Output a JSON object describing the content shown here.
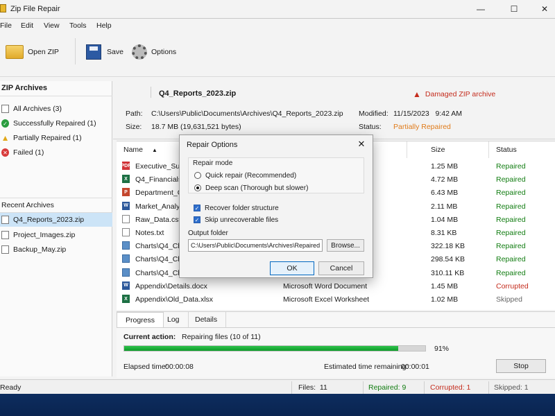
{
  "window": {
    "title": "Zip File Repair",
    "controls": {
      "minimize": "—",
      "maximize": "☐",
      "close": "✕"
    }
  },
  "menu": [
    "File",
    "Edit",
    "View",
    "Tools",
    "Help"
  ],
  "toolbar": {
    "open_label": "Open ZIP",
    "save_label": "Save",
    "options_label": "Options"
  },
  "sidebar": {
    "archives_title": "ZIP Archives",
    "filters": [
      {
        "label": "All Archives (3)",
        "icon": "files-icon"
      },
      {
        "label": "Successfully Repaired (1)",
        "icon": "check-circle-icon"
      },
      {
        "label": "Partially Repaired (1)",
        "icon": "warning-icon"
      },
      {
        "label": "Failed (1)",
        "icon": "error-icon"
      }
    ],
    "recent_title": "Recent Archives",
    "recent": [
      "Q4_Reports_2023.zip",
      "Project_Images.zip",
      "Backup_May.zip"
    ],
    "selected_recent": 0
  },
  "archive": {
    "name": "Q4_Reports_2023.zip",
    "warning": "Damaged ZIP archive",
    "path_label": "Path:",
    "path": "C:\\Users\\Public\\Documents\\Archives\\Q4_Reports_2023.zip",
    "size_label": "Size:",
    "size": "18.7 MB (19,631,521 bytes)",
    "modified_label": "Modified:",
    "modified": "11/15/2023   9:42 AM",
    "status_label": "Status:",
    "status": "Partially Repaired",
    "status_color": "#e07b1a"
  },
  "file_list": {
    "columns": {
      "name": "Name",
      "size": "Size",
      "status": "Status"
    },
    "sort_arrow": "▲",
    "rows": [
      {
        "icon": "pdf",
        "name": "Executive_Sum",
        "type": "",
        "size": "1.25 MB",
        "status": "Repaired"
      },
      {
        "icon": "xls",
        "name": "Q4_Financials.x",
        "type": "",
        "size": "4.72 MB",
        "status": "Repaired"
      },
      {
        "icon": "ppt",
        "name": "Department_O",
        "type": "",
        "size": "6.43 MB",
        "status": "Repaired"
      },
      {
        "icon": "doc",
        "name": "Market_Analys",
        "type": "",
        "size": "2.11 MB",
        "status": "Repaired"
      },
      {
        "icon": "csv",
        "name": "Raw_Data.csv",
        "type": "",
        "size": "1.04 MB",
        "status": "Repaired"
      },
      {
        "icon": "txt",
        "name": "Notes.txt",
        "type": "",
        "size": "8.31 KB",
        "status": "Repaired"
      },
      {
        "icon": "img",
        "name": "Charts\\Q4_Cha",
        "type": "",
        "size": "322.18 KB",
        "status": "Repaired"
      },
      {
        "icon": "img",
        "name": "Charts\\Q4_Cha",
        "type": "",
        "size": "298.54 KB",
        "status": "Repaired"
      },
      {
        "icon": "img",
        "name": "Charts\\Q4_Cha",
        "type": "",
        "size": "310.11 KB",
        "status": "Repaired"
      },
      {
        "icon": "doc",
        "name": "Appendix\\Details.docx",
        "type": "Microsoft Word Document",
        "size": "1.45 MB",
        "status": "Corrupted"
      },
      {
        "icon": "xls",
        "name": "Appendix\\Old_Data.xlsx",
        "type": "Microsoft Excel Worksheet",
        "size": "1.02 MB",
        "status": "Skipped"
      }
    ]
  },
  "progress": {
    "tabs": [
      "Progress",
      "Log",
      "Details"
    ],
    "current_action_label": "Current action:",
    "current_action": "Repairing files (10 of 11)",
    "percent_value": 91,
    "percent_text": "91%",
    "elapsed_label": "Elapsed time:",
    "elapsed": "00:00:08",
    "remaining_label": "Estimated time remaining:",
    "remaining": "00:00:01",
    "stop_label": "Stop"
  },
  "statusbar": {
    "ready": "Ready",
    "files": "Files:  11",
    "repaired": "Repaired: 9",
    "corrupted": "Corrupted: 1",
    "skipped": "Skipped: 1"
  },
  "dialog": {
    "title": "Repair Options",
    "close": "✕",
    "mode_title": "Repair mode",
    "quick": "Quick repair (Recommended)",
    "deep": "Deep scan  (Thorough but slower)",
    "selected_mode": "deep",
    "recover_folders": "Recover folder structure",
    "skip_unrecoverable": "Skip unrecoverable files",
    "output_label": "Output folder",
    "output_value": "C:\\Users\\Public\\Documents\\Archives\\Repaired",
    "browse": "Browse...",
    "ok": "OK",
    "cancel": "Cancel"
  },
  "colors": {
    "accent": "#0067c0",
    "repaired": "#107c10",
    "corrupted": "#c42b1c",
    "skipped": "#666666",
    "progress": "#16a832"
  }
}
